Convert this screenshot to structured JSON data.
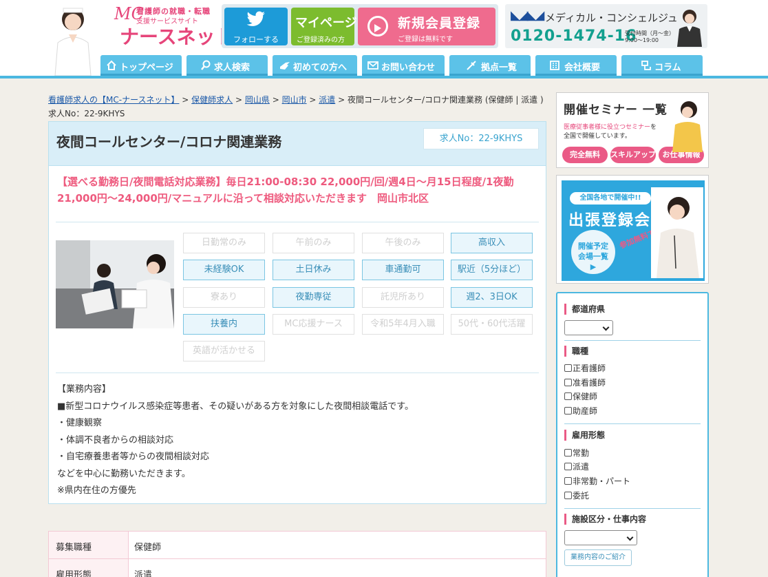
{
  "header": {
    "logo": {
      "top_text": "看護師の就職・転職",
      "sub_text": "支援サービスサイト",
      "mc": "MC",
      "main": "ナースネット"
    },
    "twitter_label": "フォローする",
    "mypage": {
      "title": "マイページ",
      "sub": "ご登録済みの方"
    },
    "register": {
      "title": "新規会員登録",
      "sub": "ご登録は無料です"
    },
    "concierge": {
      "name": "メディカル・コンシェルジュ",
      "tel": "0120-1474-16",
      "hours_line1": "受付時間（月〜金）",
      "hours_line2": "9:00〜19:00"
    }
  },
  "nav": [
    {
      "label": "トップページ",
      "icon": "home-icon"
    },
    {
      "label": "求人検索",
      "icon": "search-icon"
    },
    {
      "label": "初めての方へ",
      "icon": "pointing-hand-icon"
    },
    {
      "label": "お問い合わせ",
      "icon": "mail-icon"
    },
    {
      "label": "拠点一覧",
      "icon": "map-pin-icon"
    },
    {
      "label": "会社概要",
      "icon": "building-icon"
    },
    {
      "label": "コラム",
      "icon": "column-icon"
    }
  ],
  "breadcrumb": {
    "items": [
      "看護師求人の【MC-ナースネット】",
      "保健師求人",
      "岡山県",
      "岡山市",
      "派遣"
    ],
    "separator": " > ",
    "current": "夜間コールセンター/コロナ関連業務 (保健師 | 派遣 )",
    "job_no_line": "求人No：22-9KHYS"
  },
  "job": {
    "title": "夜間コールセンター/コロナ関連業務",
    "job_no": "求人No：22-9KHYS",
    "headline": "【選べる勤務日/夜間電話対応業務】毎日21:00-08:30 22,000円/回/週4日～月15日程度/1夜勤21,000円～24,000円/マニュアルに沿って相談対応いただきます　岡山市北区",
    "tags": [
      {
        "label": "日勤常のみ",
        "active": false
      },
      {
        "label": "午前のみ",
        "active": false
      },
      {
        "label": "午後のみ",
        "active": false
      },
      {
        "label": "高収入",
        "active": true
      },
      {
        "label": "未経験OK",
        "active": true
      },
      {
        "label": "土日休み",
        "active": true
      },
      {
        "label": "車通勤可",
        "active": true
      },
      {
        "label": "駅近（5分ほど）",
        "active": true
      },
      {
        "label": "寮あり",
        "active": false
      },
      {
        "label": "夜勤専従",
        "active": true
      },
      {
        "label": "託児所あり",
        "active": false
      },
      {
        "label": "週2、3日OK",
        "active": true
      },
      {
        "label": "扶養内",
        "active": true
      },
      {
        "label": "MC応援ナース",
        "active": false
      },
      {
        "label": "令和5年4月入職",
        "active": false
      },
      {
        "label": "50代・60代活躍",
        "active": false
      },
      {
        "label": "英語が活かせる",
        "active": false
      }
    ],
    "duties": [
      "【業務内容】",
      "■新型コロナウイルス感染症等患者、その疑いがある方を対象にした夜間相談電話です。",
      "・健康観察",
      "・体調不良者からの相談対応",
      "・自宅療養患者等からの夜間相談対応",
      "などを中心に勤務いただきます。",
      "※県内在住の方優先"
    ]
  },
  "info_table": [
    {
      "label": "募集職種",
      "value": "保健師"
    },
    {
      "label": "雇用形態",
      "value": "派遣"
    }
  ],
  "sidebar": {
    "seminar": {
      "title": "開催セミナー 一覧",
      "desc_pink": "医療従事者様に役立つセミナー",
      "desc_rest": "を",
      "desc_line2": "全国で開催しています。",
      "pills": [
        "完全無料",
        "スキルアップ",
        "お仕事情報"
      ]
    },
    "trip": {
      "band": "全国各地で開催中!!",
      "title": "出張登録会",
      "circle_line1": "開催予定",
      "circle_line2": "会場一覧",
      "circle_arrow": "▶",
      "free": "参加無料です!"
    },
    "search": {
      "prefecture_title": "都道府県",
      "job_type_title": "職種",
      "job_types": [
        "正看護師",
        "准看護師",
        "保健師",
        "助産師"
      ],
      "employment_title": "雇用形態",
      "employment_types": [
        "常勤",
        "派遣",
        "非常勤・パート",
        "委託"
      ],
      "facility_title": "施設区分・仕事内容",
      "intro_button": "業務内容のご紹介"
    }
  },
  "colors": {
    "accent_blue": "#4bb8e0",
    "pink": "#ea5a86",
    "green": "#7cbc2e",
    "twitter": "#1d9bd8"
  }
}
